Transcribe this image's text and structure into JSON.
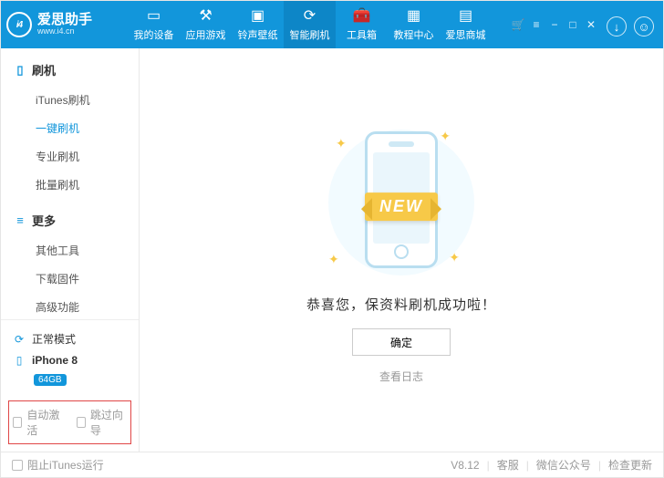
{
  "brand": {
    "logo": "i4",
    "title": "爱思助手",
    "url": "www.i4.cn"
  },
  "nav": {
    "items": [
      {
        "label": "我的设备"
      },
      {
        "label": "应用游戏"
      },
      {
        "label": "铃声壁纸"
      },
      {
        "label": "智能刷机"
      },
      {
        "label": "工具箱"
      },
      {
        "label": "教程中心"
      },
      {
        "label": "爱思商城"
      }
    ],
    "active_index": 3
  },
  "sidebar": {
    "sections": [
      {
        "title": "刷机",
        "items": [
          "iTunes刷机",
          "一键刷机",
          "专业刷机",
          "批量刷机"
        ],
        "active_index": 1
      },
      {
        "title": "更多",
        "items": [
          "其他工具",
          "下载固件",
          "高级功能"
        ],
        "active_index": -1
      }
    ],
    "status": {
      "mode": "正常模式",
      "device": "iPhone 8",
      "capacity": "64GB"
    },
    "options": {
      "auto_activate": "自动激活",
      "skip_guide": "跳过向导"
    }
  },
  "content": {
    "ribbon": "NEW",
    "message": "恭喜您，保资料刷机成功啦！",
    "ok": "确定",
    "view_log": "查看日志"
  },
  "footer": {
    "block_itunes": "阻止iTunes运行",
    "version": "V8.12",
    "links": [
      "客服",
      "微信公众号",
      "检查更新"
    ]
  }
}
